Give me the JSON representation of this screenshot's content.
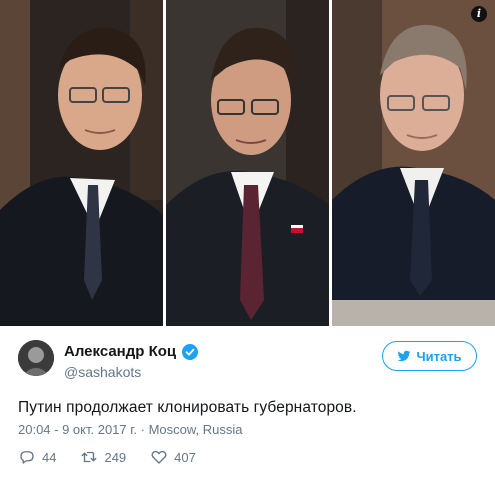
{
  "media": {
    "panels": [
      {
        "alt": "photo-left"
      },
      {
        "alt": "photo-center"
      },
      {
        "alt": "photo-right"
      }
    ],
    "info_icon": "info-icon"
  },
  "author": {
    "display_name": "Александр Коц",
    "handle": "@sashakots",
    "verified_icon": "verified-badge-icon",
    "follow_label": "Читать",
    "follow_icon": "twitter-bird-icon"
  },
  "tweet": {
    "text": "Путин продолжает клонировать губернаторов.",
    "time": "20:04 - 9 окт. 2017 г.",
    "separator": " · ",
    "location": "Moscow, Russia"
  },
  "actions": {
    "replies": "44",
    "retweets": "249",
    "likes": "407"
  },
  "colors": {
    "accent": "#1da1f2",
    "muted": "#657786",
    "text": "#14171a"
  }
}
